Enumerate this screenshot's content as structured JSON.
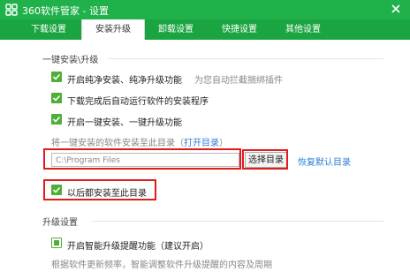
{
  "window": {
    "title": "360软件管家 - 设置"
  },
  "tabs": [
    {
      "label": "下载设置"
    },
    {
      "label": "安装升级"
    },
    {
      "label": "卸载设置"
    },
    {
      "label": "快捷设置"
    },
    {
      "label": "其他设置"
    }
  ],
  "section_install": {
    "title": "一键安装\\升级",
    "options": [
      {
        "label": "开启纯净安装、纯净升级功能",
        "hint": "为您自动拦截捆绑插件"
      },
      {
        "label": "下载完成后自动运行软件的安装程序"
      },
      {
        "label": "开启一键安装、一键升级功能"
      }
    ],
    "dir_prompt": "将一键安装的软件安装至此目录（",
    "open_dir_link": "打开目录",
    "dir_prompt_end": "）",
    "path_value": "C:\\Program Files",
    "browse_button": "选择目录",
    "restore_link": "恢复默认目录",
    "always_label": "以后都安装至此目录"
  },
  "section_upgrade": {
    "title": "升级设置",
    "option_label": "开启智能升级提醒功能（建议开启）",
    "note": "根据软件更新频率，智能调整软件升级提醒的内容及周期"
  },
  "colors": {
    "titlebar": "#21b14b",
    "tabbar": "#1ba542",
    "checkbox": "#4fae38",
    "highlight": "#e21b1b",
    "link": "#2d7dd8"
  }
}
